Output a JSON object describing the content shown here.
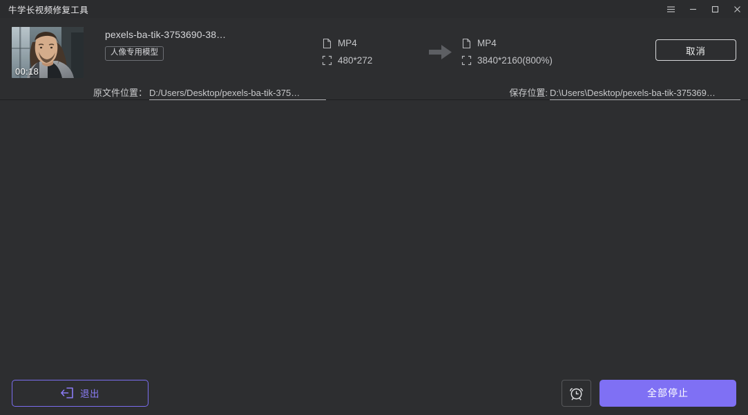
{
  "window": {
    "title": "牛学长视频修复工具",
    "controls": [
      {
        "name": "menu-icon",
        "glyph": "menu"
      },
      {
        "name": "minimize-icon",
        "glyph": "minimize"
      },
      {
        "name": "maximize-icon",
        "glyph": "maximize"
      },
      {
        "name": "close-icon",
        "glyph": "close"
      }
    ]
  },
  "colors": {
    "window_background": "#2d2e30",
    "titlebar_background": "#2b2c2e",
    "accent_purple": "#7f70f4",
    "accent_purple_text": "#8b7cf6",
    "divider": "#1e1f21",
    "text_primary": "#d6d7da",
    "text_secondary": "#c4c5c8"
  },
  "task": {
    "thumbnail": {
      "icon": "video-thumbnail",
      "duration": "00:18"
    },
    "file_name": "pexels-ba-tik-3753690-38…",
    "model_badge": "人像专用模型",
    "source": {
      "format_icon": "file-icon",
      "format": "MP4",
      "resolution_icon": "resolution-icon",
      "resolution": "480*272"
    },
    "arrow_icon": "arrow-right-icon",
    "destination": {
      "format_icon": "file-icon",
      "format": "MP4",
      "resolution_icon": "resolution-icon",
      "resolution": "3840*2160(800%)"
    },
    "cancel_label": "取消",
    "source_path": {
      "label": "原文件位置：",
      "value": "D:/Users/Desktop/pexels-ba-tik-375…"
    },
    "save_path": {
      "label": "保存位置:",
      "value": "D:\\Users\\Desktop/pexels-ba-tik-375369…"
    }
  },
  "bottom_bar": {
    "exit_label": "退出",
    "exit_icon": "exit-arrow-icon",
    "timer_icon": "alarm-clock-icon",
    "stop_all_label": "全部停止"
  }
}
